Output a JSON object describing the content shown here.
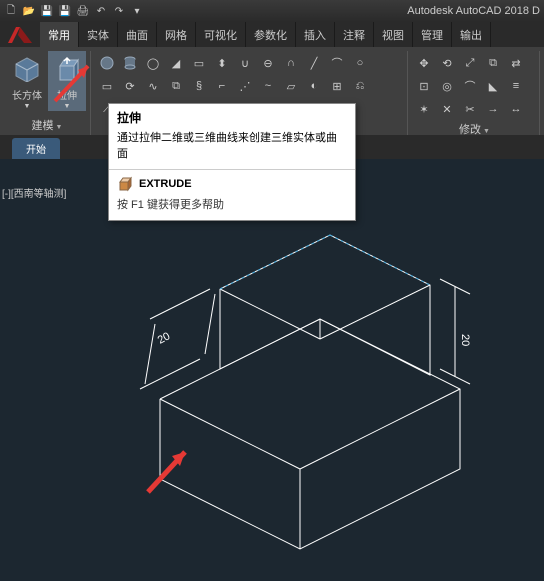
{
  "app_title": "Autodesk AutoCAD 2018   D",
  "menu_tabs": [
    "常用",
    "实体",
    "曲面",
    "网格",
    "可视化",
    "参数化",
    "插入",
    "注释",
    "视图",
    "管理",
    "输出"
  ],
  "active_tab": "常用",
  "ribbon": {
    "modeling_big": [
      {
        "label": "长方体"
      },
      {
        "label": "拉伸"
      }
    ],
    "panel_modeling": "建模",
    "panel_modify": "修改"
  },
  "doc_tab": "开始",
  "view_label": "[-][西南等轴测]",
  "tooltip": {
    "title": "拉伸",
    "desc": "通过拉伸二维或三维曲线来创建三维实体或曲面",
    "cmd": "EXTRUDE",
    "help": "按 F1 键获得更多帮助"
  },
  "dims": {
    "d1": "20",
    "d2": "20"
  }
}
